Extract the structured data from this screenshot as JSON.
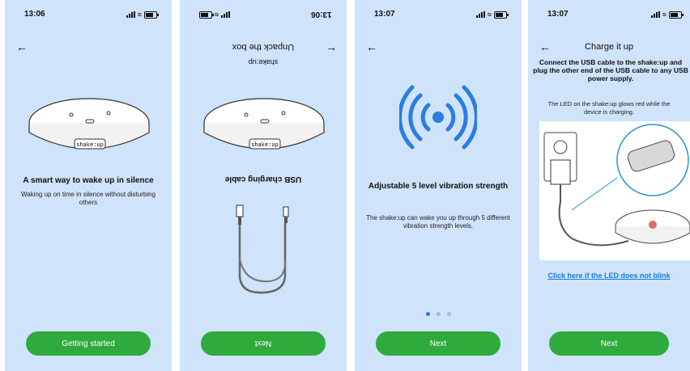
{
  "screens": [
    {
      "time": "13:06",
      "heading": "A smart way to wake up in silence",
      "description": "Waking up on time in silence without disturbing others",
      "button": "Getting started"
    },
    {
      "time": "13:06",
      "title": "Unpack the box",
      "subtitle": "shake:up",
      "heading": "USB charging cable",
      "button": "Next"
    },
    {
      "time": "13:07",
      "heading": "Adjustable 5 level vibration strength",
      "description": "The shake:up can wake you up through 5 different vibration strength levels.",
      "button": "Next"
    },
    {
      "time": "13:07",
      "title": "Charge it up",
      "heading": "Connect the USB cable to the shake:up and plug the other end of the USB cable to any USB power supply.",
      "description": "The LED on the shake:up glows red while the device is charging.",
      "link": "Click here if the LED does not blink",
      "button": "Next"
    }
  ],
  "device_label": "shake:up",
  "pager": {
    "count": 3,
    "active_index": 0
  },
  "colors": {
    "screen_bg": "#cfe3fb",
    "button": "#2faa3d",
    "accent": "#2a7de1",
    "link": "#1a7fd4"
  }
}
